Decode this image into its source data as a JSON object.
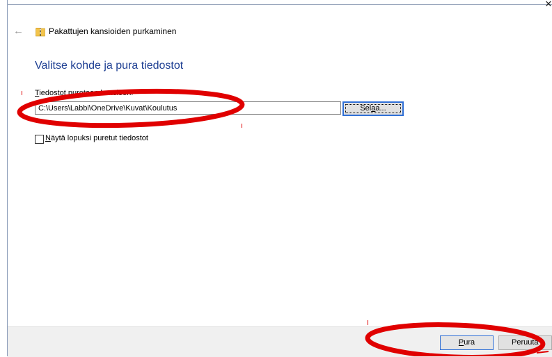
{
  "window": {
    "title": "Pakattujen kansioiden purkaminen",
    "close_glyph": "✕",
    "back_glyph": "←"
  },
  "main": {
    "heading": "Valitse kohde ja pura tiedostot",
    "field_label_accel": "T",
    "field_label_rest": "iedostot puretaan kansioon:",
    "path_value": "C:\\Users\\Labbi\\OneDrive\\Kuvat\\Koulutus",
    "browse_label_pre": "Sel",
    "browse_label_accel": "a",
    "browse_label_post": "a...",
    "checkbox_label_accel": "N",
    "checkbox_label_rest": "äytä lopuksi puretut tiedostot"
  },
  "footer": {
    "extract_accel": "P",
    "extract_rest": "ura",
    "cancel_label": "Peruuta"
  },
  "colors": {
    "heading": "#1e3f93",
    "focus_border": "#2f6fd6",
    "annotation_red": "#e00000",
    "footer_bg": "#f0f0f0"
  },
  "icons": {
    "window": "zip-folder-icon",
    "back": "arrow-left-icon",
    "close": "close-icon"
  }
}
